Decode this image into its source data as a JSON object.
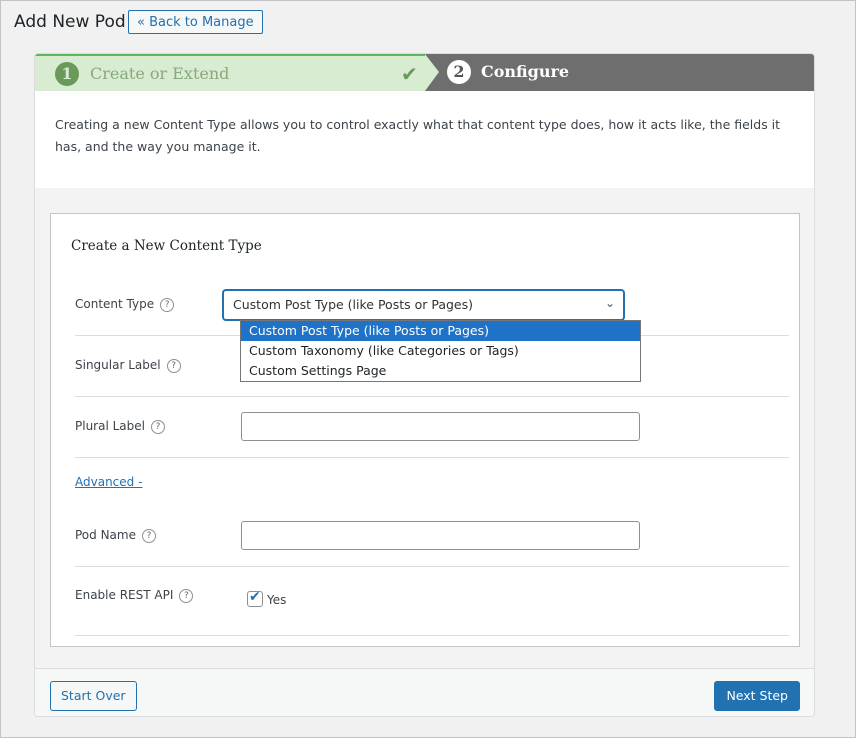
{
  "header": {
    "title": "Add New Pod",
    "back_label": "« Back to Manage"
  },
  "steps": [
    {
      "number": "1",
      "label": "Create or Extend",
      "status": "complete"
    },
    {
      "number": "2",
      "label": "Configure",
      "status": "active"
    }
  ],
  "intro": "Creating a new Content Type allows you to control exactly what that content type does, how it acts like, the fields it has, and the way you manage it.",
  "panel": {
    "title": "Create a New Content Type",
    "content_type": {
      "label": "Content Type",
      "value": "Custom Post Type (like Posts or Pages)",
      "options": [
        "Custom Post Type (like Posts or Pages)",
        "Custom Taxonomy (like Categories or Tags)",
        "Custom Settings Page"
      ]
    },
    "singular_label": {
      "label": "Singular Label",
      "value": ""
    },
    "plural_label": {
      "label": "Plural Label",
      "value": ""
    },
    "advanced": "Advanced -",
    "pod_name": {
      "label": "Pod Name",
      "value": ""
    },
    "rest_api": {
      "label": "Enable REST API",
      "checkbox_label": "Yes",
      "checked": true
    }
  },
  "footer": {
    "start_over": "Start Over",
    "next_step": "Next Step"
  },
  "colors": {
    "accent": "#2271b1",
    "step_done": "#d7ecd0",
    "step_active": "#6e6e6e"
  }
}
